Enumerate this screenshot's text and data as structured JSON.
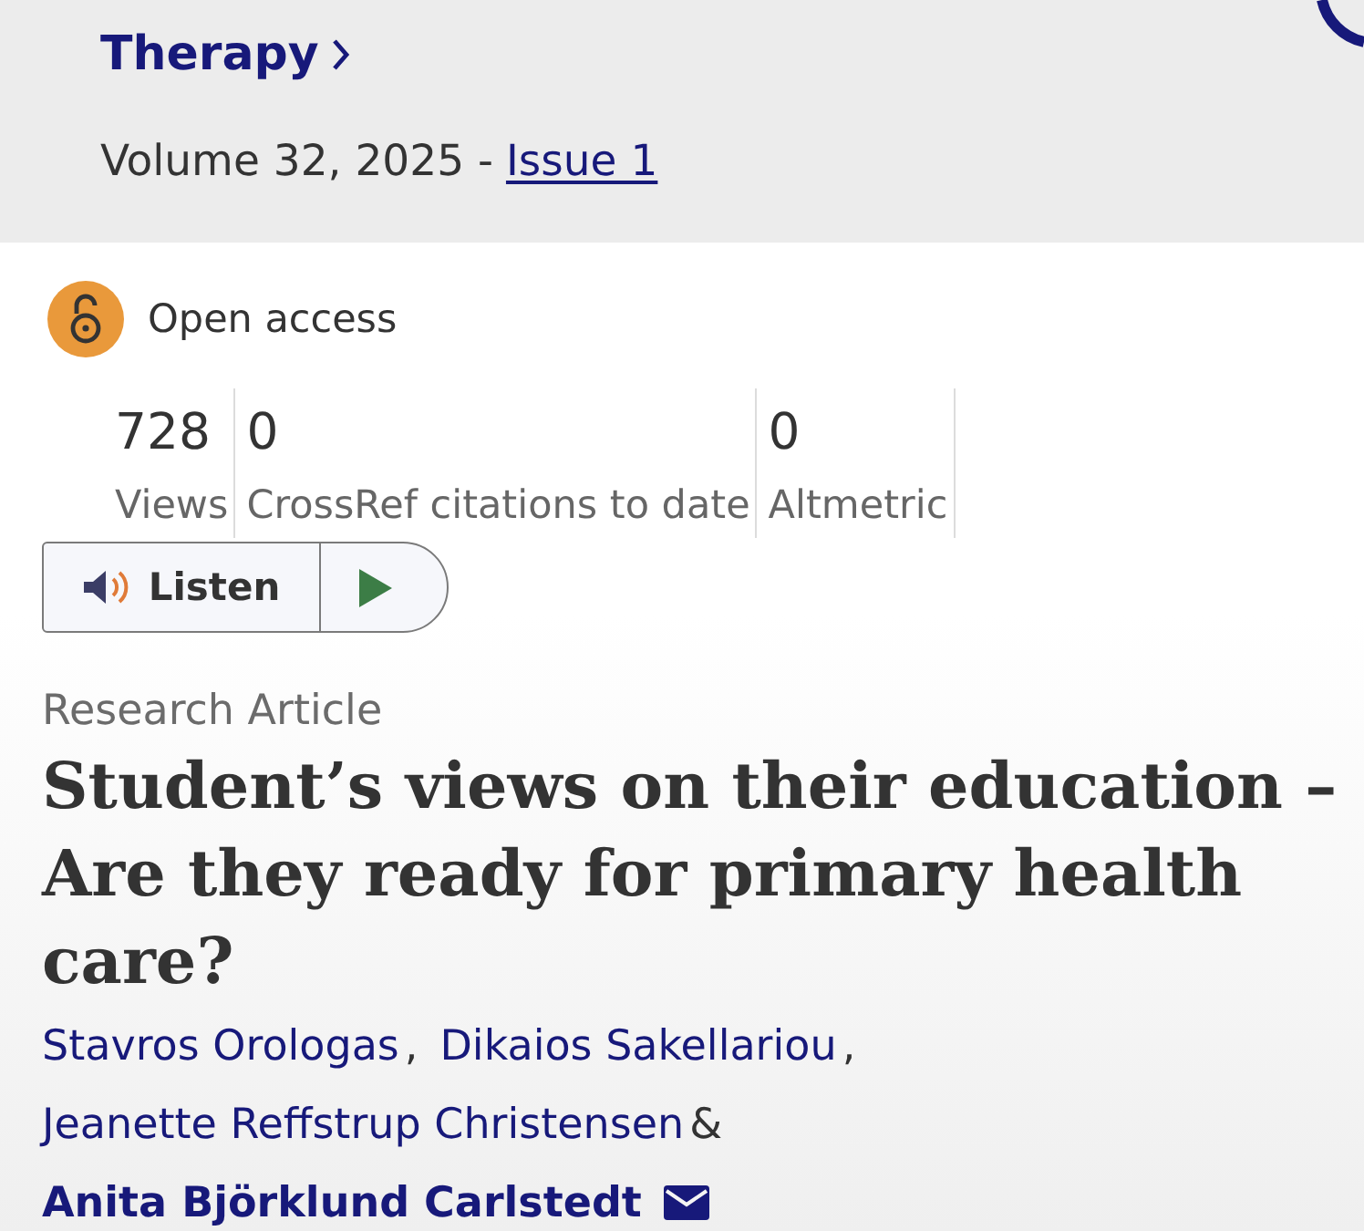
{
  "journal": {
    "title": "Therapy",
    "volume": "Volume 32, 2025 -",
    "issue": "Issue 1"
  },
  "access": {
    "label": "Open access"
  },
  "metrics": [
    {
      "value": "728",
      "label": "Views"
    },
    {
      "value": "0",
      "label": "CrossRef citations to date"
    },
    {
      "value": "0",
      "label": "Altmetric"
    }
  ],
  "listen": {
    "label": "Listen"
  },
  "article": {
    "type": "Research Article",
    "title": "Student’s views on their education – Are they ready for primary health care?"
  },
  "authors": [
    {
      "name": "Stavros Orologas",
      "separator": ",",
      "corresponding": false
    },
    {
      "name": "Dikaios Sakellariou",
      "separator": ",",
      "corresponding": false
    },
    {
      "name": "Jeanette Reffstrup Christensen",
      "separator": "&",
      "corresponding": false
    },
    {
      "name": "Anita Björklund Carlstedt",
      "corresponding": true
    }
  ]
}
